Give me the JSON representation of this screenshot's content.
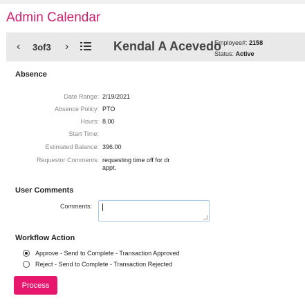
{
  "app": {
    "title": "Admin Calendar"
  },
  "nav": {
    "prev_icon": "chevron-left-icon",
    "prev_glyph": "‹",
    "count": "3of3",
    "next_icon": "chevron-right-icon",
    "next_glyph": "›",
    "list_icon": "list-icon"
  },
  "employee": {
    "name": "Kendal A Acevedo",
    "number_label": "Employee#:",
    "number": "2158",
    "status_label": "Status:",
    "status": "Active"
  },
  "absence": {
    "heading": "Absence",
    "fields": [
      {
        "label": "Date Range:",
        "value": "2/19/2021"
      },
      {
        "label": "Absence Policy:",
        "value": "PTO"
      },
      {
        "label": "Hours:",
        "value": "8.00"
      },
      {
        "label": "Start Time:",
        "value": ""
      },
      {
        "label": "Estimated Balance:",
        "value": "396.00"
      },
      {
        "label": "Requestor Comments:",
        "value": "requesting time off for dr\nappt."
      }
    ]
  },
  "user_comments": {
    "heading": "User Comments",
    "label": "Comments:",
    "value": ""
  },
  "workflow": {
    "heading": "Workflow Action",
    "options": [
      {
        "label": "Approve - Send to Complete - Transaction Approved",
        "checked": true
      },
      {
        "label": "Reject - Send to Complete - Transaction Rejected",
        "checked": false
      }
    ]
  },
  "actions": {
    "process_label": "Process"
  },
  "colors": {
    "brand": "#d0206e",
    "button": "#e8176e",
    "navbar": "#e9e9ea"
  }
}
